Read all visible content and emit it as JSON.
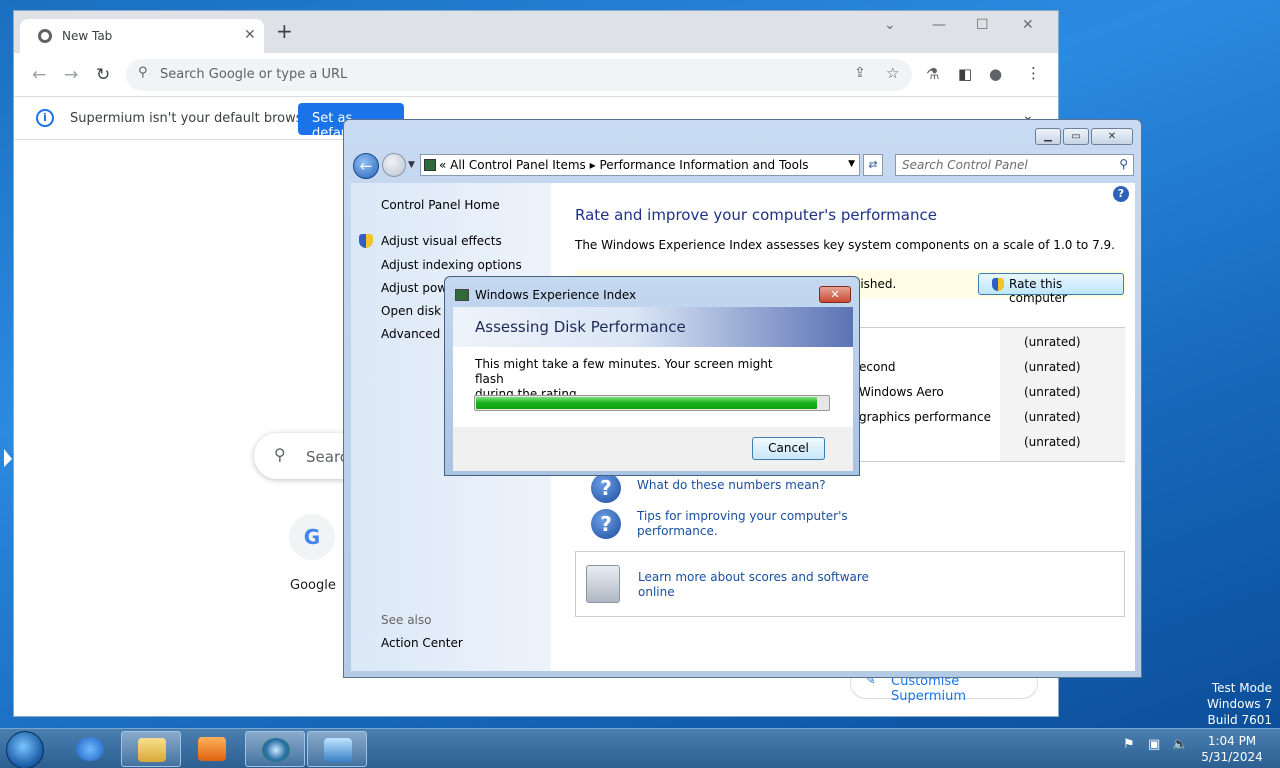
{
  "watermark": {
    "line1": "Test Mode",
    "line2": "Windows 7",
    "line3": "Build 7601"
  },
  "browser": {
    "tab_title": "New Tab",
    "omnibox_placeholder": "Search Google or type a URL",
    "infobar_text": "Supermium isn't your default browser",
    "infobar_button": "Set as default",
    "search_placeholder": "Search",
    "shortcut_label": "Google",
    "shortcut_letter": "G",
    "customise_label": "Customise Supermium"
  },
  "control_panel": {
    "address": {
      "part1": "All Control Panel Items",
      "part2": "Performance Information and Tools"
    },
    "search_placeholder": "Search Control Panel",
    "home_link": "Control Panel Home",
    "sidebar": [
      "Adjust visual effects",
      "Adjust indexing options",
      "Adjust power settings",
      "Open disk cleanup",
      "Advanced tools"
    ],
    "see_also_label": "See also",
    "see_also_item": "Action Center",
    "heading": "Rate and improve your computer's performance",
    "description": "The Windows Experience Index assesses key system components on a scale of 1.0 to 7.9.",
    "notice_text": "lished.",
    "rate_button": "Rate this computer",
    "rows": [
      {
        "label": "",
        "value": "(unrated)"
      },
      {
        "label": "econd",
        "value": "(unrated)"
      },
      {
        "label": "Windows Aero",
        "value": "(unrated)"
      },
      {
        "label": "graphics performance",
        "value": "(unrated)"
      },
      {
        "label": "",
        "value": "(unrated)"
      }
    ],
    "help_link_1": "What do these numbers mean?",
    "help_link_2_line1": "Tips for improving your computer's",
    "help_link_2_line2": "performance.",
    "learn_line1": "Learn more about scores and software",
    "learn_line2": "online"
  },
  "dialog": {
    "title": "Windows Experience Index",
    "banner": "Assessing Disk Performance",
    "message_line1": "This might take a few minutes. Your screen might flash",
    "message_line2": "during the rating.",
    "progress": 0.97,
    "cancel": "Cancel"
  },
  "clock": {
    "time": "1:04 PM",
    "date": "5/31/2024"
  },
  "colors": {
    "accent": "#1a73e8",
    "progress": "#18b018",
    "cp_heading": "#1e3287"
  }
}
